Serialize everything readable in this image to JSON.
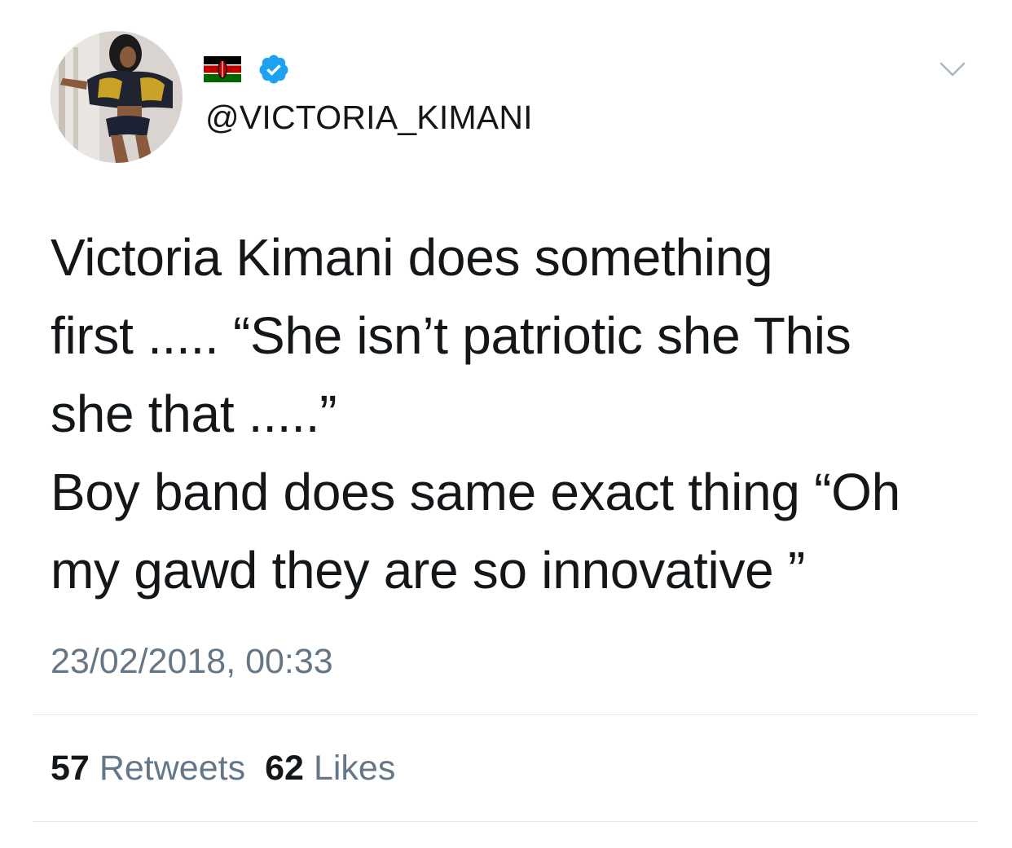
{
  "tweet": {
    "handle": "@VICTORIA_KIMANI",
    "flag_icon": "kenya-flag-icon",
    "verified_icon": "verified-badge-icon",
    "menu_icon": "chevron-down-icon",
    "body_lines": [
      "Victoria Kimani does something",
      "first ..... “She isn’t patriotic she This",
      "she that .....”",
      "Boy band does same exact thing “Oh",
      "my gawd they are so innovative ”"
    ],
    "timestamp": "23/02/2018, 00:33",
    "stats": {
      "retweets_count": "57",
      "retweets_label": "Retweets",
      "likes_count": "62",
      "likes_label": "Likes"
    }
  },
  "colors": {
    "text": "#14171a",
    "secondary": "#657786",
    "verified": "#1da1f2",
    "divider": "#e1e8ed"
  }
}
